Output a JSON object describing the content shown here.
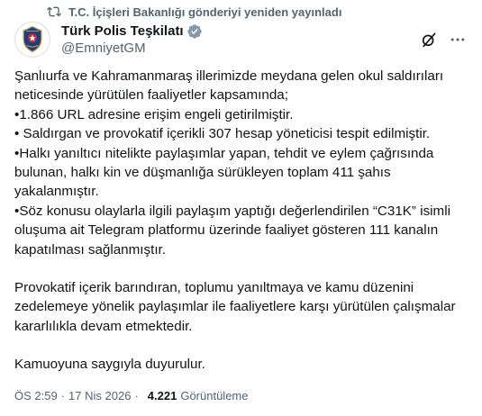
{
  "repost": {
    "text": "T.C. İçişleri Bakanlığı gönderiyi yeniden yayınladı",
    "icon": "repost-icon"
  },
  "author": {
    "display_name": "Türk Polis Teşkilatı",
    "handle": "@EmniyetGM",
    "verified_color": "#829aab"
  },
  "actions": {
    "grok_icon": "grok-icon",
    "more_icon": "more-icon"
  },
  "post": {
    "lines": [
      "Şanlıurfa ve Kahramanmaraş illerimizde meydana gelen okul saldırıları",
      "neticesinde yürütülen faaliyetler kapsamında;",
      "•1.866 URL adresine erişim engeli getirilmiştir.",
      "• Saldırgan ve provokatif içerikli 307 hesap yöneticisi tespit edilmiştir.",
      "•Halkı yanıltıcı nitelikte paylaşımlar yapan, tehdit ve eylem çağrısında",
      "bulunan, halkı kin ve düşmanlığa sürükleyen toplam 411 şahıs",
      "yakalanmıştır.",
      "•Söz konusu olaylarla ilgili paylaşım yaptığı değerlendirilen “C31K” isimli",
      "oluşuma ait Telegram platformu üzerinde faaliyet gösteren 111 kanalın",
      "kapatılması sağlanmıştır.",
      "Provokatif içerik barındıran, toplumu yanıltmaya ve kamu düzenini",
      "zedelemeye yönelik paylaşımlar ile faaliyetlere karşı yürütülen çalışmalar",
      "kararlılıkla devam etmektedir.",
      "Kamuoyuna saygıyla duyurulur."
    ]
  },
  "meta": {
    "time": "ÖS 2:59",
    "separator": "·",
    "date": "17 Nis 2026",
    "views": "4.221",
    "views_label": "Görüntüleme"
  }
}
